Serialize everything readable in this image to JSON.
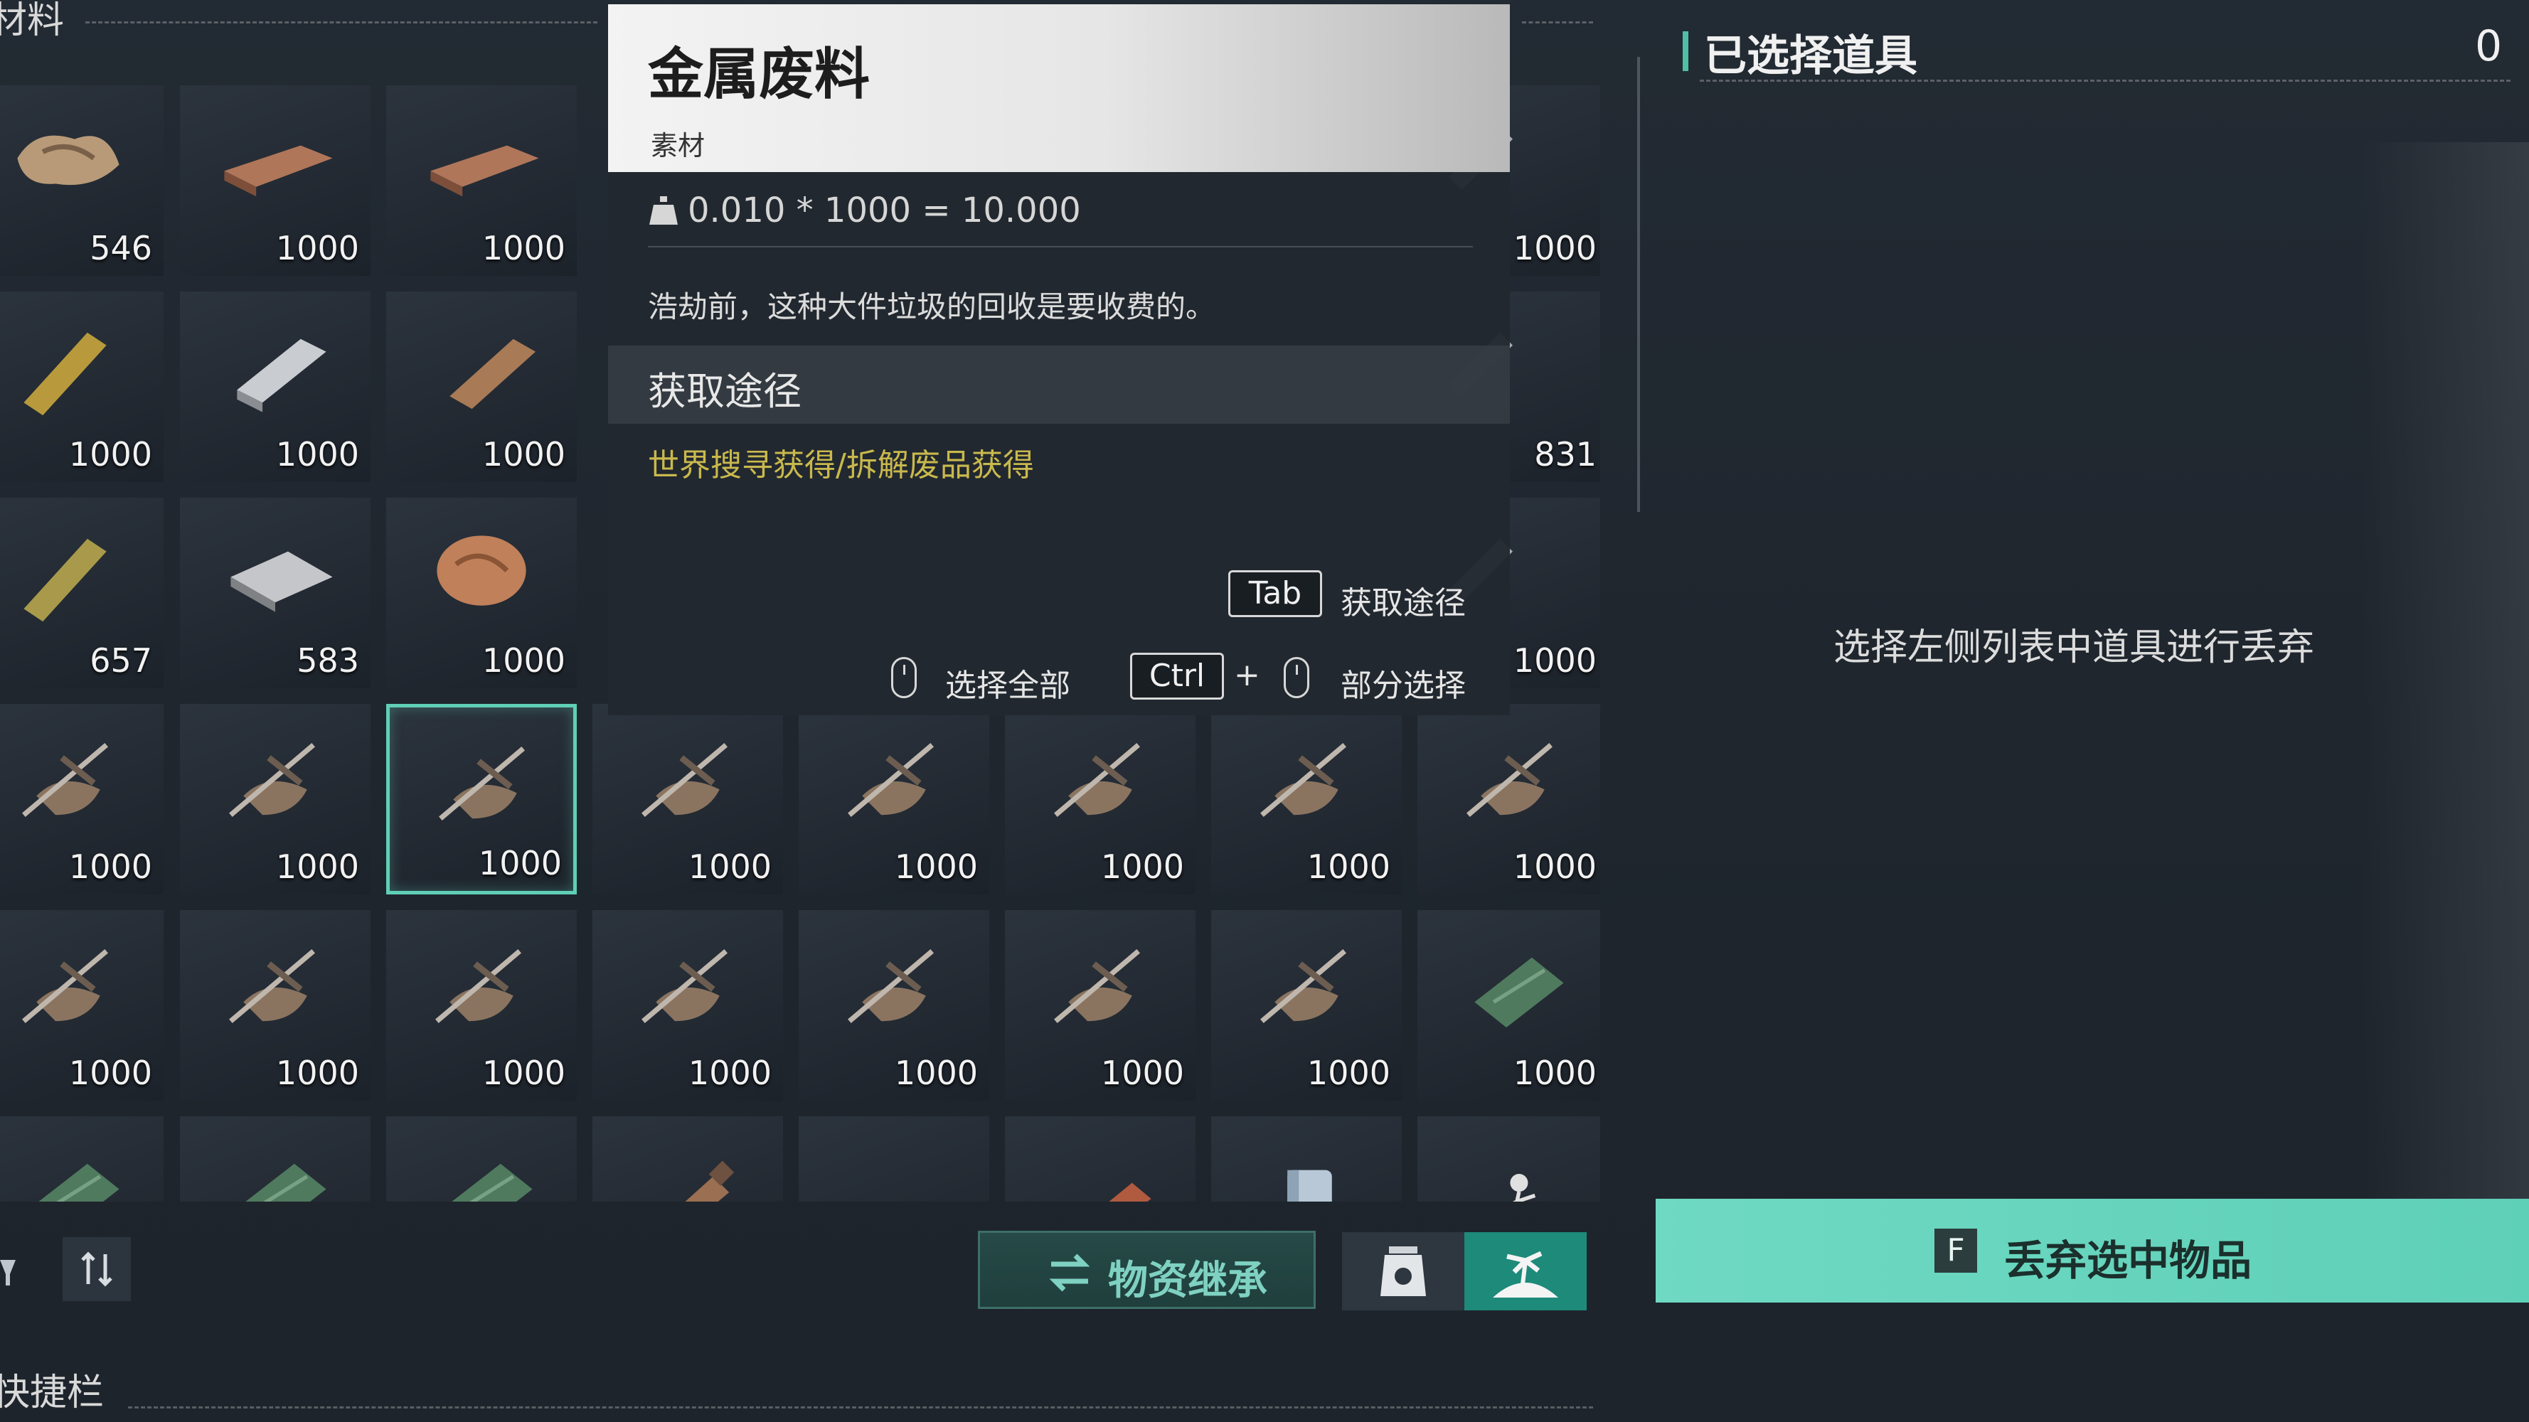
{
  "section": {
    "materials_label": "材料",
    "quickbar_label": "快捷栏"
  },
  "inventory": {
    "rows": [
      [
        {
          "icon": "scrap-pile-icon",
          "qty": "546"
        },
        {
          "icon": "wood-plank-icon",
          "qty": "1000"
        },
        {
          "icon": "wood-plank-icon",
          "qty": "1000"
        },
        null,
        null,
        null,
        null,
        {
          "icon": "metal-blade-icon",
          "qty": "1000"
        }
      ],
      [
        {
          "icon": "brass-ingot-icon",
          "qty": "1000"
        },
        {
          "icon": "steel-ingot-icon",
          "qty": "1000"
        },
        {
          "icon": "copper-ingot-icon",
          "qty": "1000"
        },
        null,
        null,
        null,
        null,
        {
          "icon": "metal-blade-icon",
          "qty": "831"
        }
      ],
      [
        {
          "icon": "gold-ingot-icon",
          "qty": "657"
        },
        {
          "icon": "metal-plate-icon",
          "qty": "583"
        },
        {
          "icon": "ore-chunk-icon",
          "qty": "1000"
        },
        null,
        null,
        null,
        null,
        {
          "icon": "metal-blade-icon",
          "qty": "1000"
        }
      ],
      [
        {
          "icon": "metal-scrap-icon",
          "qty": "1000"
        },
        {
          "icon": "metal-scrap-icon",
          "qty": "1000"
        },
        {
          "icon": "metal-scrap-icon",
          "qty": "1000",
          "selected": true
        },
        {
          "icon": "metal-scrap-icon",
          "qty": "1000"
        },
        {
          "icon": "metal-scrap-icon",
          "qty": "1000"
        },
        {
          "icon": "metal-scrap-icon",
          "qty": "1000"
        },
        {
          "icon": "metal-scrap-icon",
          "qty": "1000"
        },
        {
          "icon": "metal-scrap-icon",
          "qty": "1000"
        }
      ],
      [
        {
          "icon": "metal-scrap-icon",
          "qty": "1000"
        },
        {
          "icon": "metal-scrap-icon",
          "qty": "1000"
        },
        {
          "icon": "metal-scrap-icon",
          "qty": "1000"
        },
        {
          "icon": "metal-scrap-icon",
          "qty": "1000"
        },
        {
          "icon": "metal-scrap-icon",
          "qty": "1000"
        },
        {
          "icon": "metal-scrap-icon",
          "qty": "1000"
        },
        {
          "icon": "metal-scrap-icon",
          "qty": "1000"
        },
        {
          "icon": "cloth-bundle-icon",
          "qty": "1000"
        }
      ],
      [
        {
          "icon": "cloth-bundle-icon",
          "qty": ""
        },
        {
          "icon": "cloth-bundle-icon",
          "qty": ""
        },
        {
          "icon": "cloth-bundle-icon",
          "qty": ""
        },
        {
          "icon": "bottle-icon",
          "qty": ""
        },
        {
          "icon": "cloth-pile-icon",
          "qty": ""
        },
        {
          "icon": "log-icon",
          "qty": ""
        },
        {
          "icon": "canister-icon",
          "qty": ""
        },
        {
          "icon": "figure-icon",
          "qty": ""
        }
      ]
    ]
  },
  "tooltip": {
    "title": "金属废料",
    "category": "素材",
    "weight_text": "0.010 * 1000 = 10.000",
    "description": "浩劫前，这种大件垃圾的回收是要收费的。",
    "source_heading": "获取途径",
    "source_text": "世界搜寻获得/拆解废品获得",
    "hints": {
      "tab_key": "Tab",
      "tab_label": "获取途径",
      "select_all_label": "选择全部",
      "ctrl_key": "Ctrl",
      "plus": "+",
      "partial_label": "部分选择"
    }
  },
  "bottom_bar": {
    "inherit_label": "物资继承"
  },
  "right_panel": {
    "title": "已选择道具",
    "count": "0",
    "empty_text": "选择左侧列表中道具进行丢弃",
    "drop_key": "F",
    "drop_label": "丢弃选中物品"
  },
  "colors": {
    "accent": "#5fcfb6",
    "source_text": "#c9b94d"
  }
}
